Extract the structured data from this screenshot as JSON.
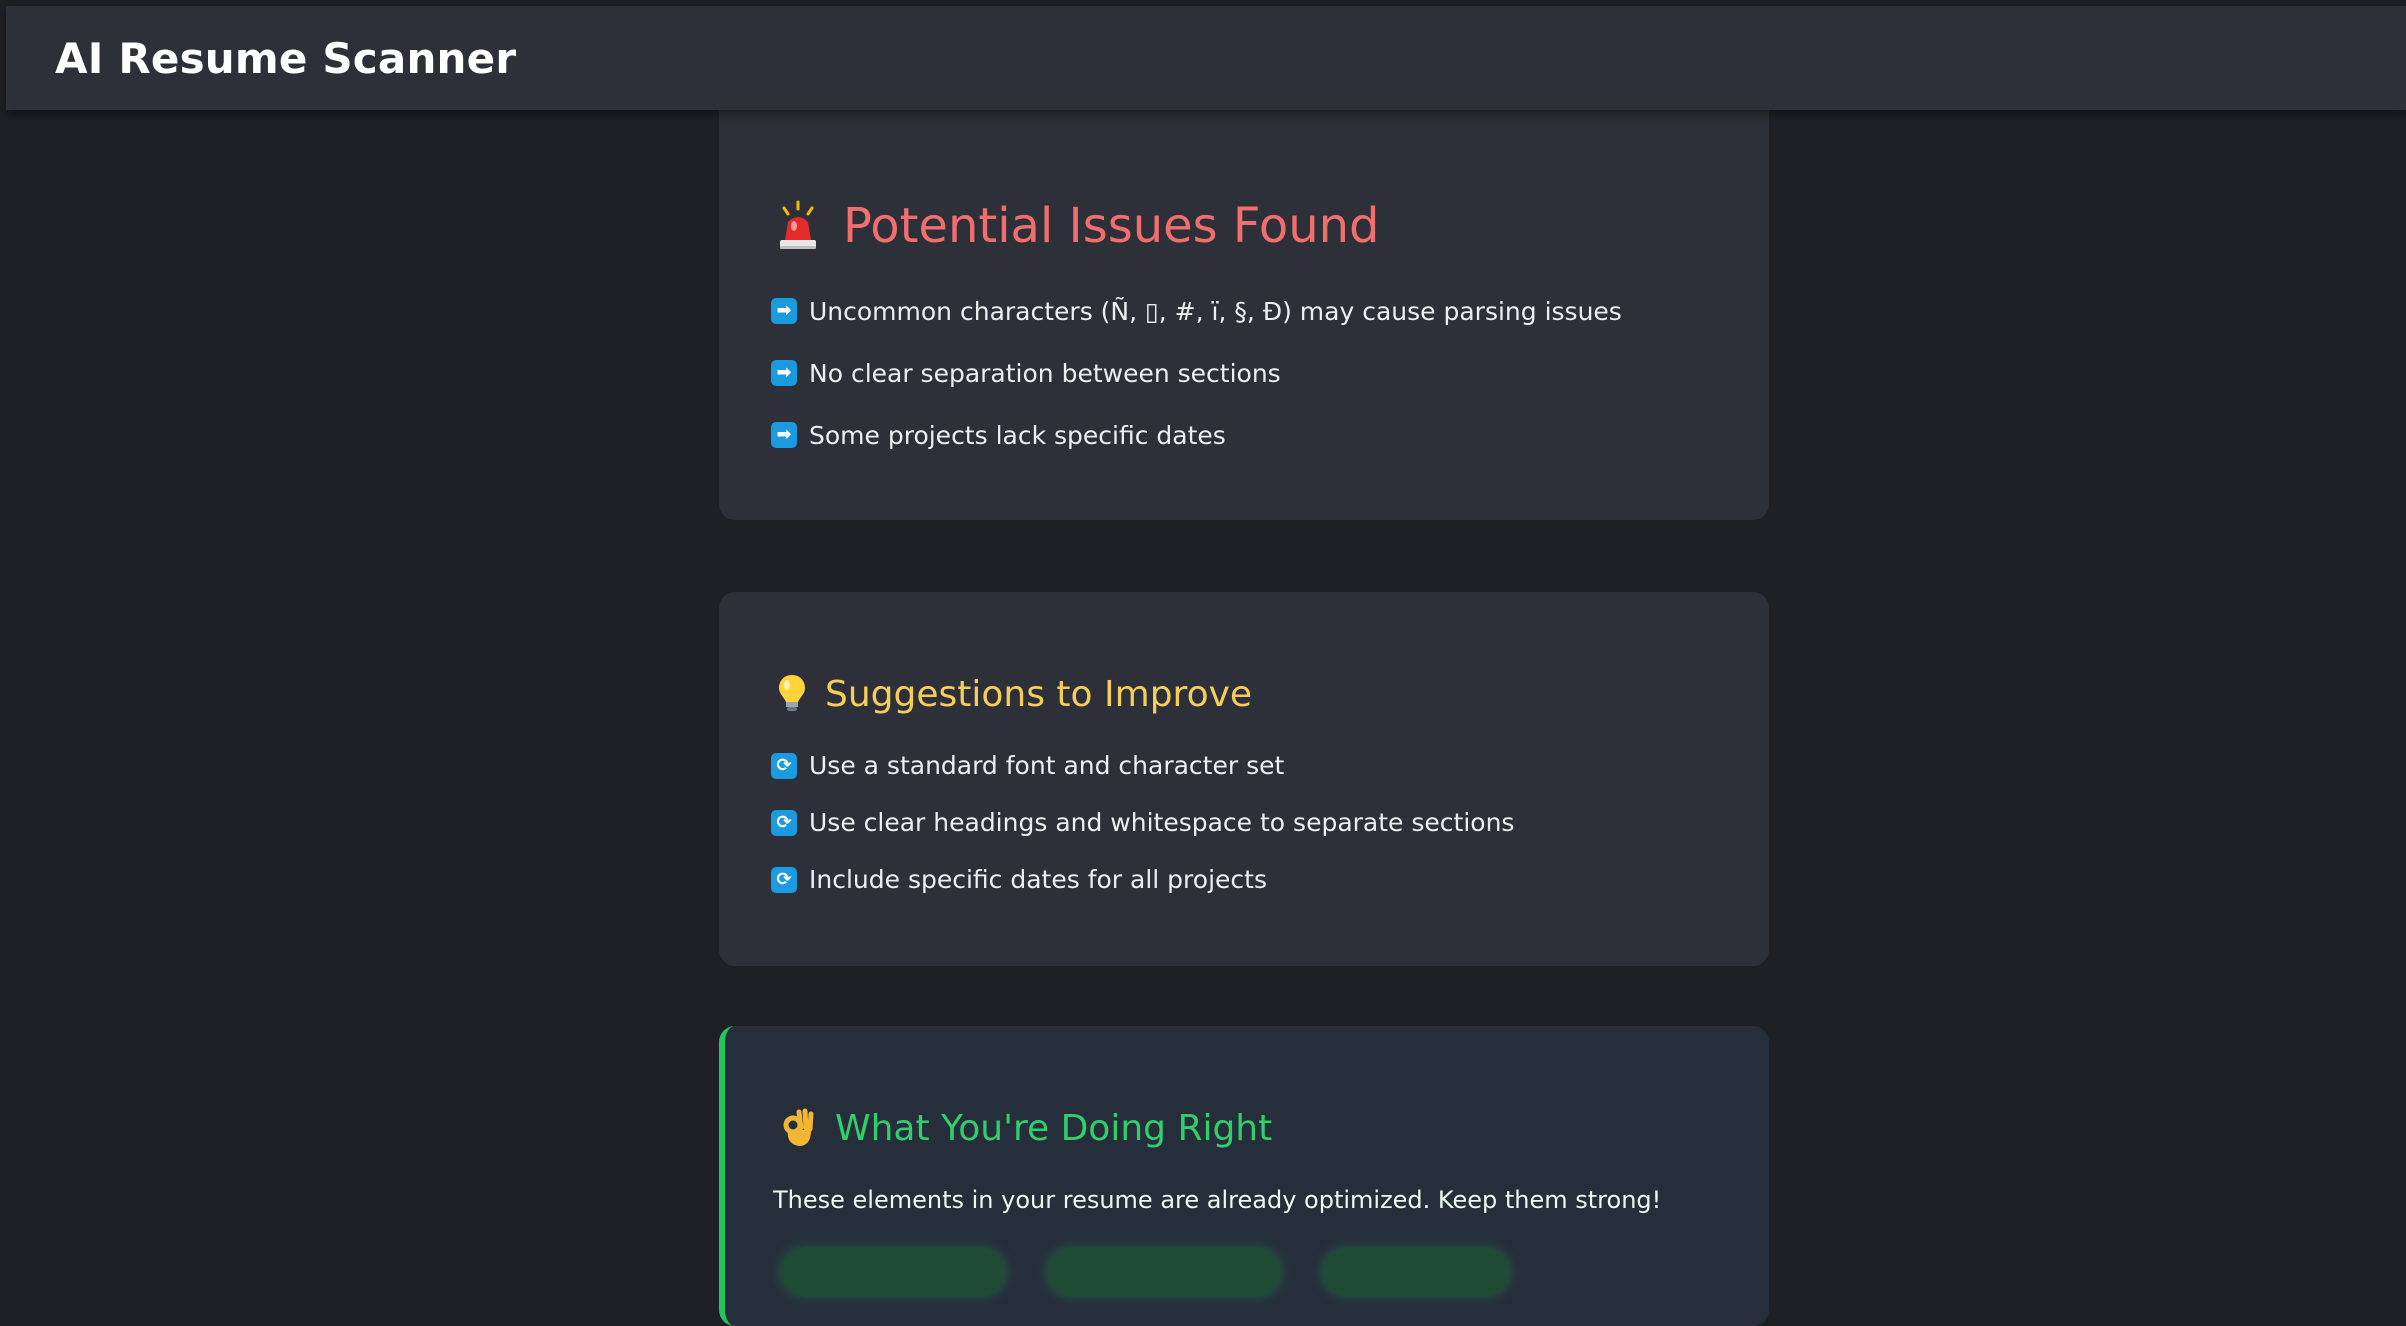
{
  "header": {
    "title": "AI Resume Scanner"
  },
  "issues": {
    "title": "Potential Issues Found",
    "icon": "siren-icon",
    "bullet_icon": "right-arrow-icon",
    "items": [
      "Uncommon characters (Ñ, ▯, #, ï, §, Ð) may cause parsing issues",
      "No clear separation between sections",
      "Some projects lack specific dates"
    ]
  },
  "suggestions": {
    "title": "Suggestions to Improve",
    "icon": "lightbulb-icon",
    "bullet_icon": "refresh-icon",
    "items": [
      "Use a standard font and character set",
      "Use clear headings and whitespace to separate sections",
      "Include specific dates for all projects"
    ]
  },
  "doing_right": {
    "title": "What You're Doing Right",
    "icon": "ok-hand-icon",
    "description": "These elements in your resume are already optimized. Keep them strong!"
  },
  "colors": {
    "background": "#1e2026",
    "card": "#2d3038",
    "issues_accent": "#f26d6d",
    "suggestions_accent": "#f5cd58",
    "success_accent": "#22c55e",
    "bullet": "#1b9ae0"
  }
}
